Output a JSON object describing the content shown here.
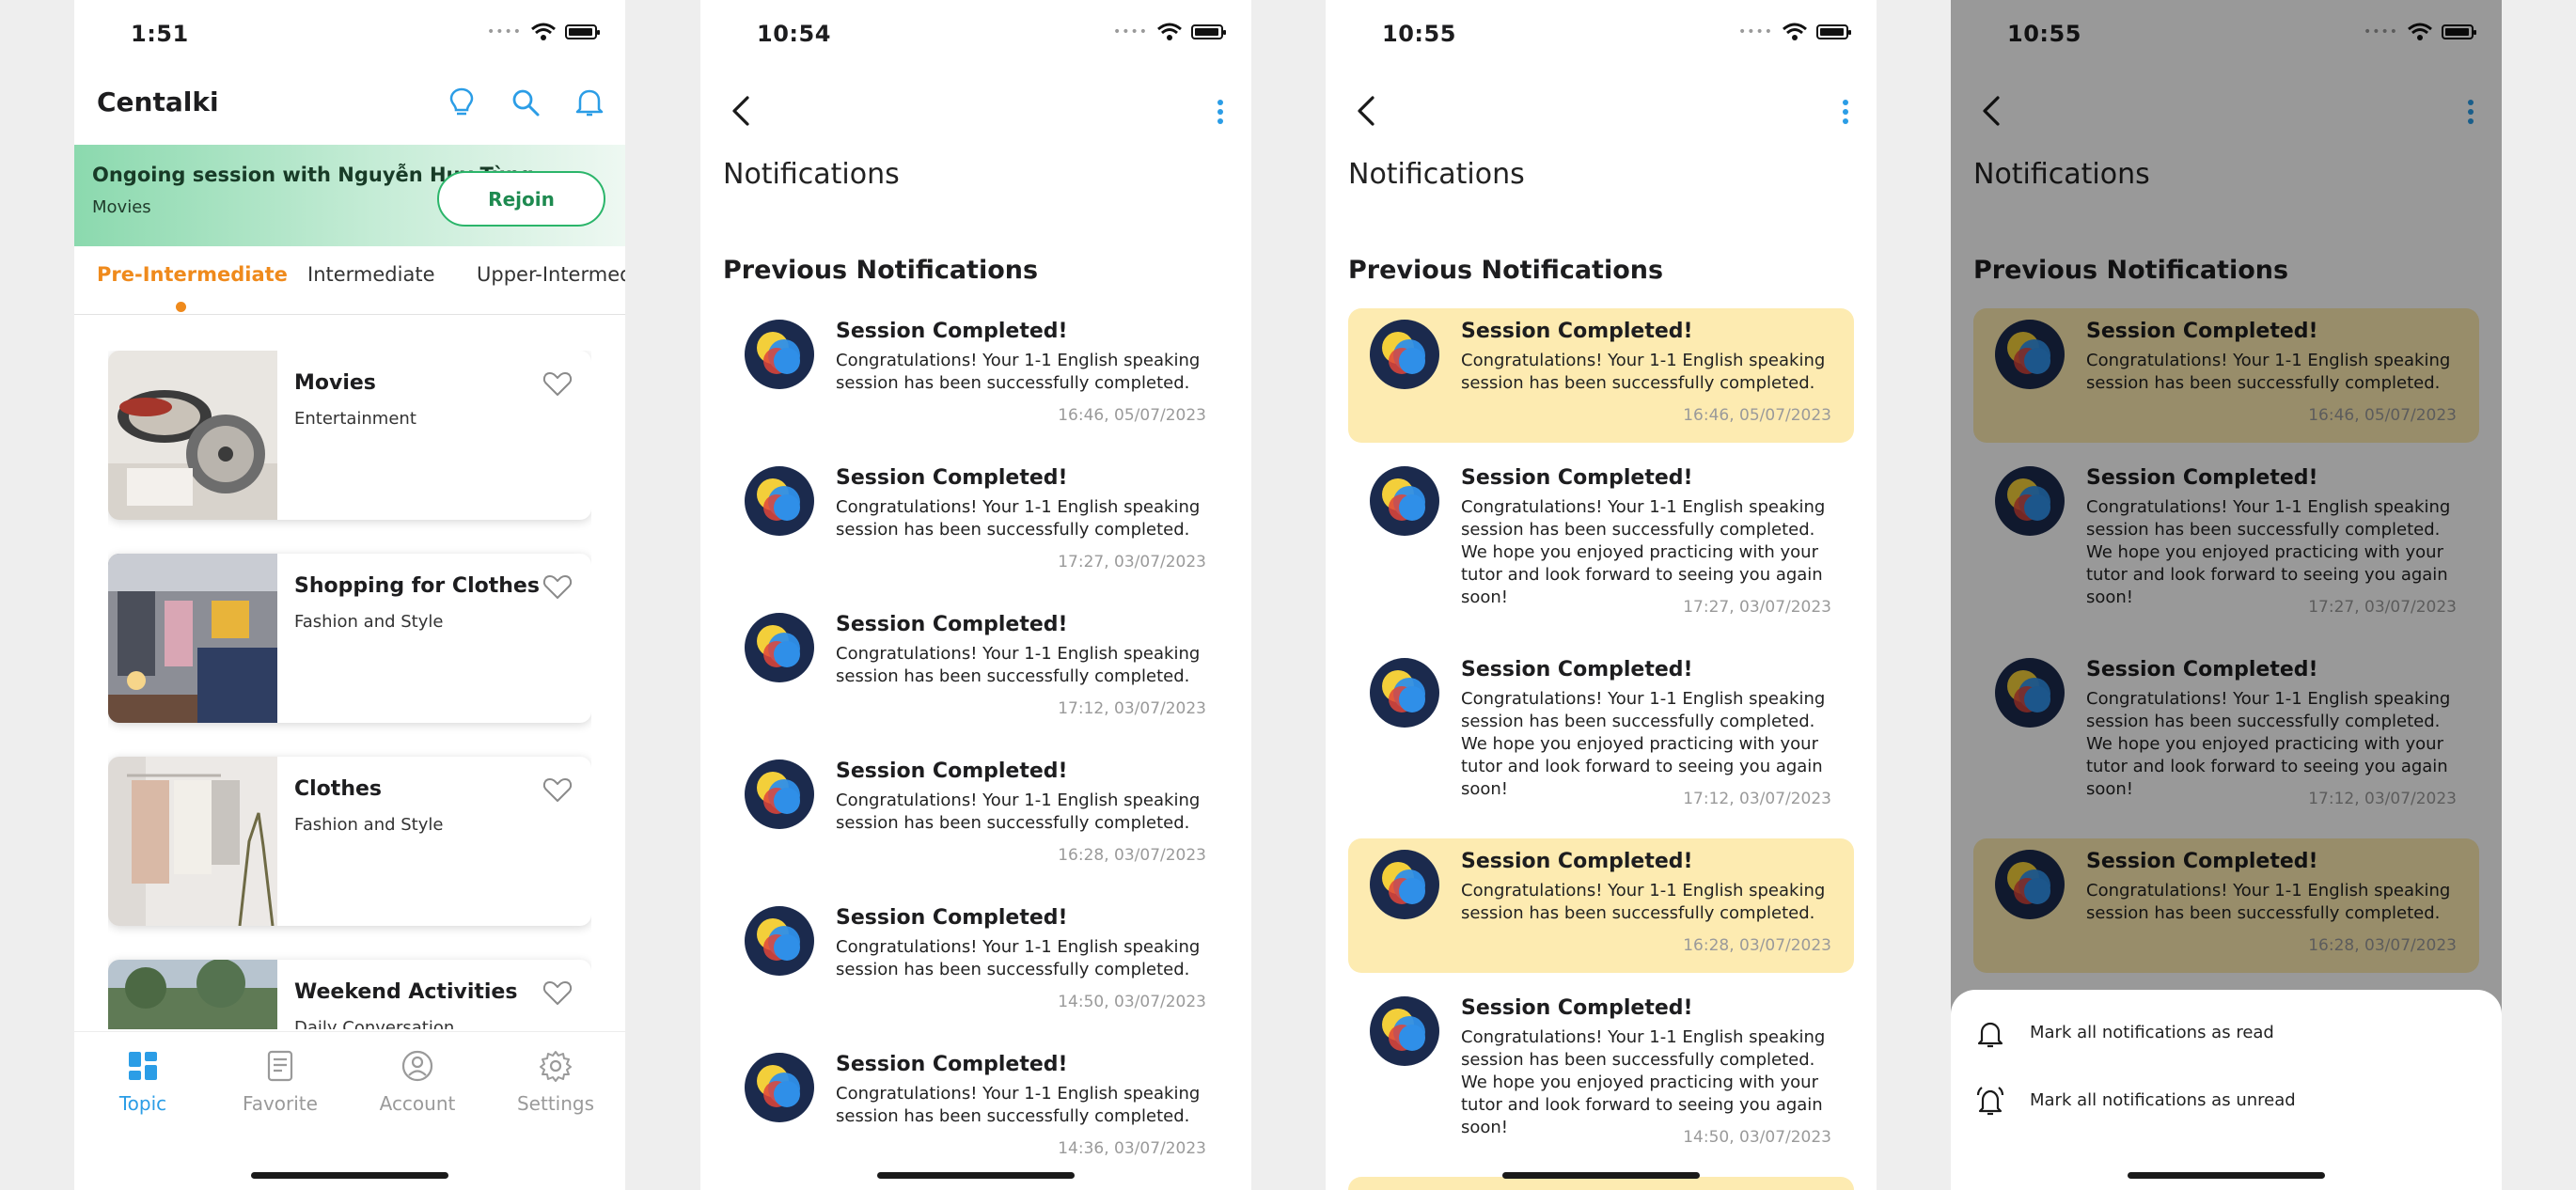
{
  "phones": [
    {
      "status": {
        "time": "1:51"
      }
    },
    {
      "status": {
        "time": "10:54"
      }
    },
    {
      "status": {
        "time": "10:55"
      }
    },
    {
      "status": {
        "time": "10:55"
      }
    }
  ],
  "home": {
    "app_title": "Centalki",
    "header_icons": [
      "lightbulb-icon",
      "search-icon",
      "bell-icon"
    ],
    "banner": {
      "title": "Ongoing session with Nguyễn Huy Tùng",
      "subtitle": "Movies",
      "button": "Rejoin"
    },
    "tabs": [
      "Pre-Intermediate",
      "Intermediate",
      "Upper-Intermediate"
    ],
    "active_tab": "Pre-Intermediate",
    "topics": [
      {
        "title": "Movies",
        "category": "Entertainment"
      },
      {
        "title": "Shopping for Clothes",
        "category": "Fashion and Style"
      },
      {
        "title": "Clothes",
        "category": "Fashion and Style"
      },
      {
        "title": "Weekend Activities",
        "category": "Daily Conversation"
      }
    ],
    "nav": [
      {
        "label": "Topic",
        "icon": "grid-icon"
      },
      {
        "label": "Favorite",
        "icon": "list-icon"
      },
      {
        "label": "Account",
        "icon": "user-icon"
      },
      {
        "label": "Settings",
        "icon": "gear-icon"
      }
    ]
  },
  "notifications": {
    "title": "Notifications",
    "section": "Previous Notifications",
    "item_title": "Session Completed!",
    "item_body": "Congratulations! Your 1-1 English speaking session has been successfully completed. We hope you enjoyed practicing with your tutor and look forward to seeing you again soon!",
    "item_body_truncated": "Congratulations! Your 1-1 English speaking session has been successfully completed. W...",
    "times": [
      "16:46, 05/07/2023",
      "17:27, 03/07/2023",
      "17:12, 03/07/2023",
      "16:28, 03/07/2023",
      "14:50, 03/07/2023",
      "14:36, 03/07/2023"
    ],
    "read_state": [
      "unread",
      "read",
      "read",
      "unread",
      "read",
      "unread"
    ]
  },
  "menu": {
    "mark_read": "Mark all notifications as read",
    "mark_unread": "Mark all notifications as unread"
  },
  "colors": {
    "accent_orange": "#ef8a1c",
    "accent_blue": "#2b9de6",
    "rejoin_green": "#2bb56a",
    "unread_bg": "#fdebb1"
  }
}
